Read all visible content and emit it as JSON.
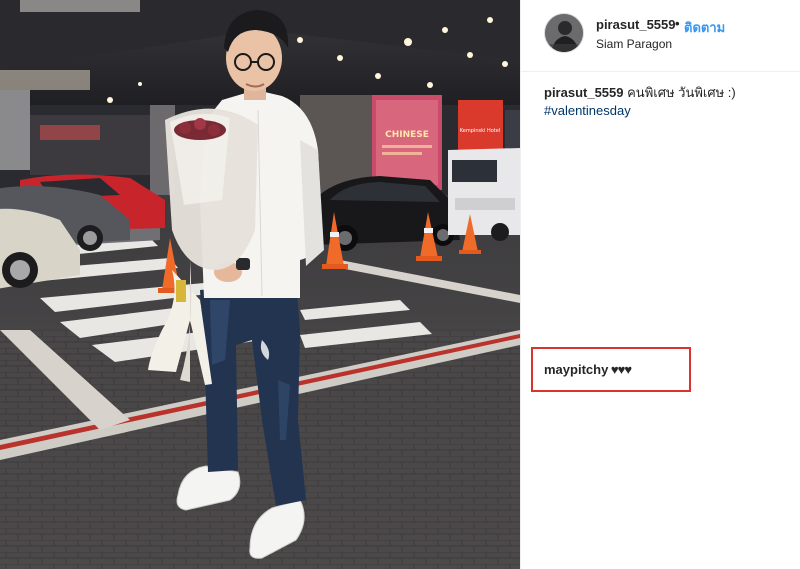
{
  "post": {
    "username": "pirasut_5559",
    "separator": "•",
    "follow_label": "ติดตาม",
    "location": "Siam Paragon",
    "avatar_icon": "profile-avatar"
  },
  "caption": {
    "username": "pirasut_5559",
    "text": " คนพิเศษ วันพิเศษ :)",
    "hashtag": "#valentinesday"
  },
  "comment": {
    "username": "maypitchy",
    "text": " ♥♥♥"
  },
  "photo": {
    "sign_text": "CHINESE",
    "hotel_sign": "Kempinski Hotel"
  },
  "colors": {
    "follow": "#3897f0",
    "hashtag": "#003569",
    "highlight_box": "#d9342b"
  }
}
